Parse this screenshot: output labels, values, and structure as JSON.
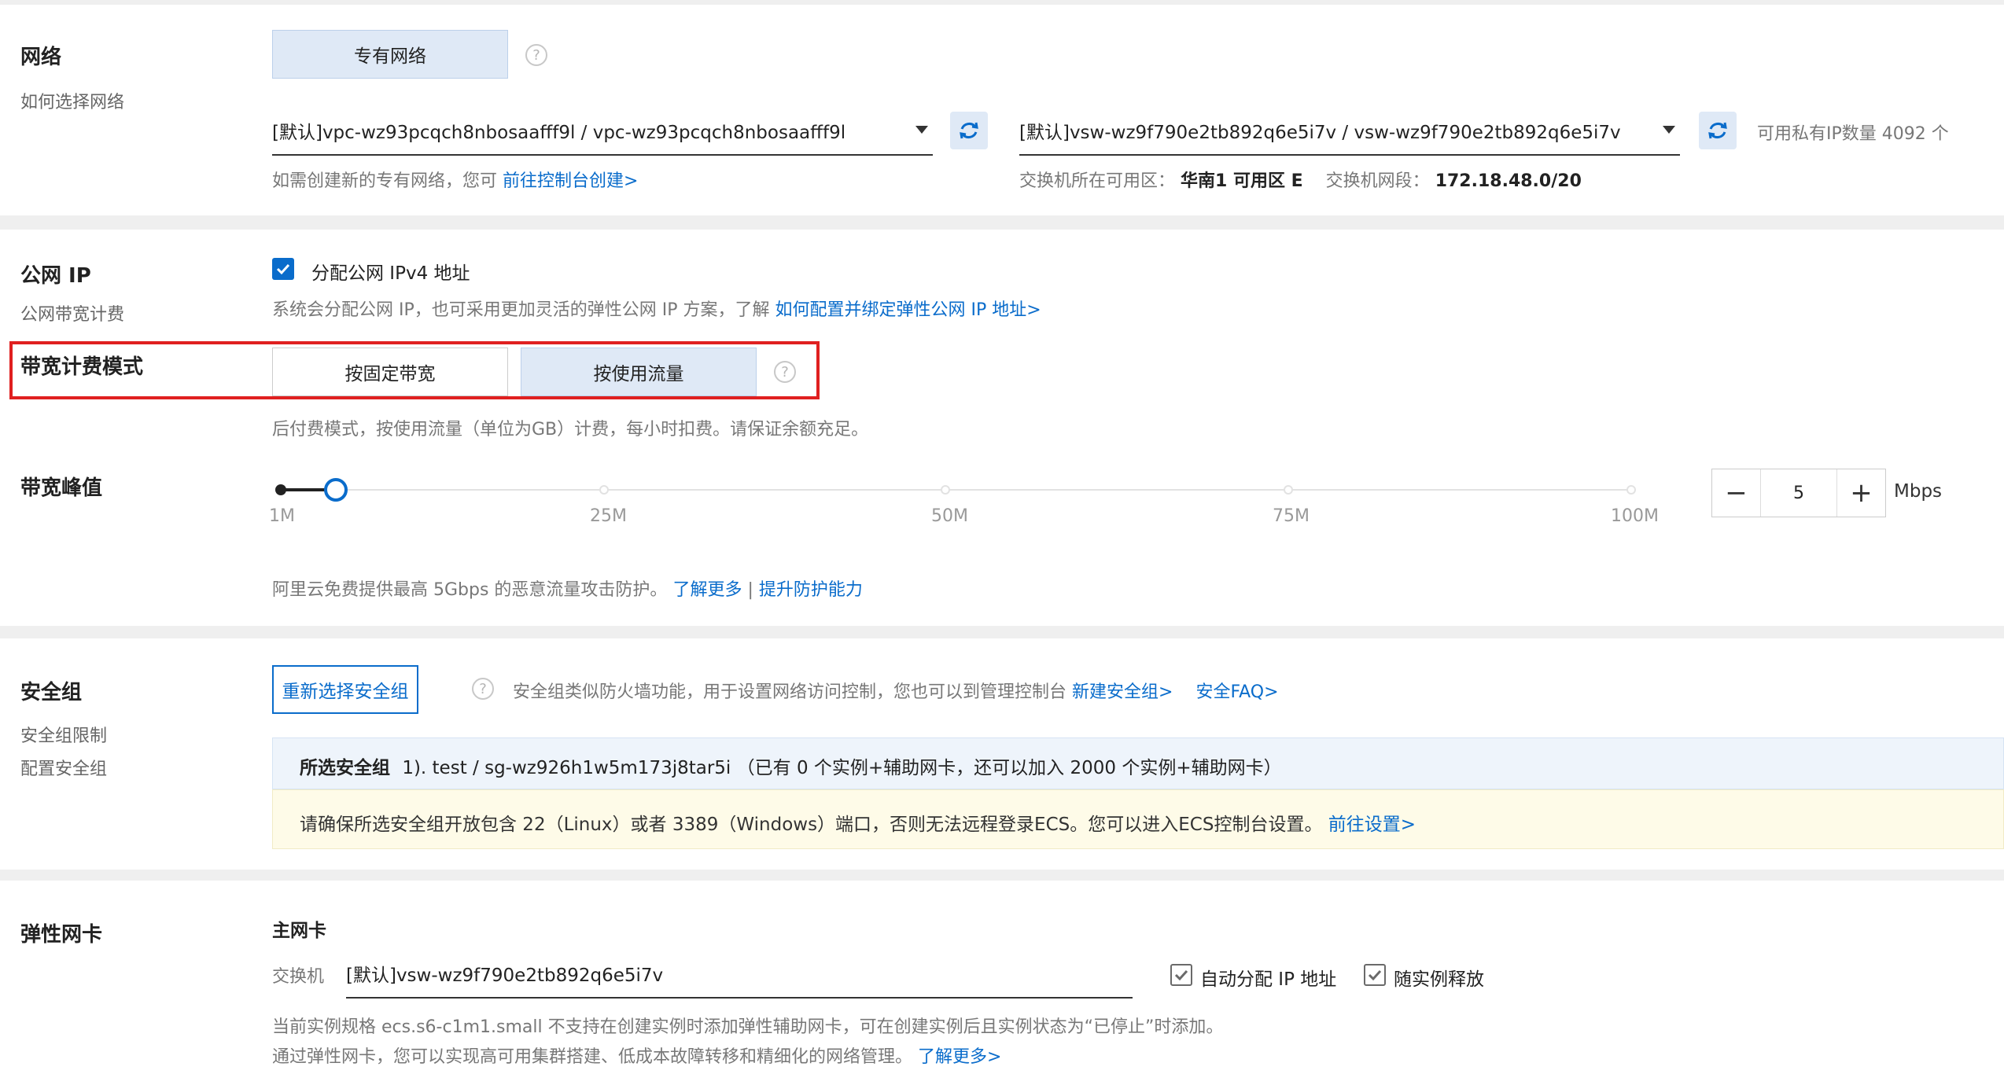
{
  "network": {
    "title": "网络",
    "subtitle": "如何选择网络",
    "vpc_type_button": "专有网络",
    "vpc_select": "[默认]vpc-wz93pcqch8nbosaafff9l / vpc-wz93pcqch8nbosaafff9l",
    "vswitch_select": "[默认]vsw-wz9f790e2tb892q6e5i7v / vsw-wz9f790e2tb892q6e5i7v",
    "available_ip": "可用私有IP数量 4092 个",
    "create_hint": "如需创建新的专有网络，您可",
    "create_link": "前往控制台创建>",
    "zone_label": "交换机所在可用区：",
    "zone_value": "华南1 可用区 E",
    "cidr_label": "交换机网段：",
    "cidr_value": "172.18.48.0/20"
  },
  "public_ip": {
    "title": "公网 IP",
    "subtitle": "公网带宽计费",
    "checkbox_label": "分配公网 IPv4 地址",
    "checked": true,
    "hint": "系统会分配公网 IP，也可采用更加灵活的弹性公网 IP 方案，了解",
    "hint_link": "如何配置并绑定弹性公网 IP 地址>"
  },
  "billing": {
    "title": "带宽计费模式",
    "option_fixed": "按固定带宽",
    "option_traffic": "按使用流量",
    "selected": "按使用流量",
    "hint": "后付费模式，按使用流量（单位为GB）计费，每小时扣费。请保证余额充足。"
  },
  "bandwidth": {
    "title": "带宽峰值",
    "ticks": [
      "1M",
      "25M",
      "50M",
      "75M",
      "100M"
    ],
    "min": 1,
    "max": 100,
    "value": 5,
    "unit": "Mbps",
    "minus": "−",
    "plus": "+",
    "ddos_hint": "阿里云免费提供最高 5Gbps 的恶意流量攻击防护。",
    "learn_more": "了解更多",
    "separator": "|",
    "upgrade": "提升防护能力"
  },
  "security_group": {
    "title": "安全组",
    "sub1": "安全组限制",
    "sub2": "配置安全组",
    "reselect_button": "重新选择安全组",
    "hint": "安全组类似防火墙功能，用于设置网络访问控制，您也可以到管理控制台",
    "new_link": "新建安全组>",
    "faq_link": "安全FAQ>",
    "selected_label": "所选安全组",
    "selected_value": "1). test / sg-wz926h1w5m173j8tar5i （已有 0 个实例+辅助网卡，还可以加入 2000 个实例+辅助网卡）",
    "warning": "请确保所选安全组开放包含 22（Linux）或者 3389（Windows）端口，否则无法远程登录ECS。您可以进入ECS控制台设置。",
    "warning_link": "前往设置>"
  },
  "eni": {
    "title": "弹性网卡",
    "primary_label": "主网卡",
    "switch_label": "交换机",
    "switch_value": "[默认]vsw-wz9f790e2tb892q6e5i7v",
    "auto_ip_label": "自动分配 IP 地址",
    "release_label": "随实例释放",
    "note1": "当前实例规格 ecs.s6-c1m1.small 不支持在创建实例时添加弹性辅助网卡，可在创建实例后且实例状态为“已停止”时添加。",
    "note2": "通过弹性网卡，您可以实现高可用集群搭建、低成本故障转移和精细化的网络管理。",
    "note2_link": "了解更多>"
  },
  "colors": {
    "accent": "#0a6ccb",
    "highlight_border": "#e02020",
    "active_segment": "#dfe9f6",
    "warning_bg": "#fefbe8",
    "info_bg": "#eef4fb"
  }
}
